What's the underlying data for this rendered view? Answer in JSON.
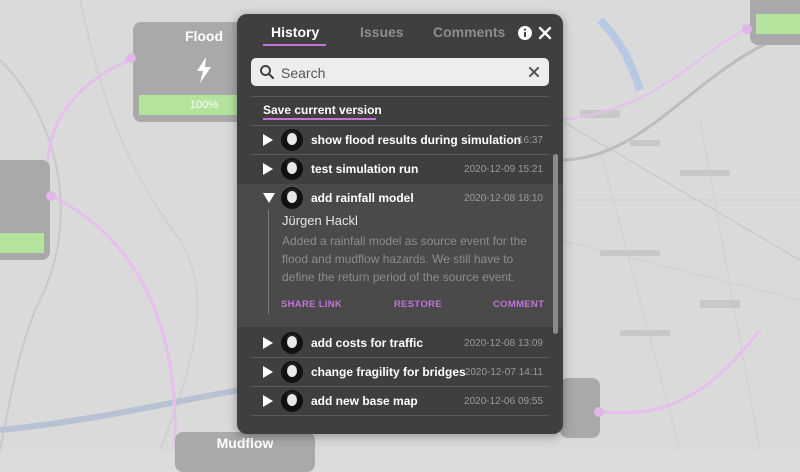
{
  "background_nodes": {
    "flood": {
      "title": "Flood",
      "progress_label": "100%",
      "progress": 1.0
    },
    "mudflow": {
      "title": "Mudflow"
    }
  },
  "panel": {
    "tabs": [
      "History",
      "Issues",
      "Comments"
    ],
    "active_tab": "History",
    "search": {
      "placeholder": "Search",
      "value": ""
    },
    "save_label": "Save current version",
    "history": [
      {
        "title": "show flood results during simulation",
        "time": "16:37"
      },
      {
        "title": "test simulation run",
        "time": "2020-12-09 15:21"
      },
      {
        "title": "add rainfall model",
        "time": "2020-12-08 18:10",
        "author": "Jürgen Hackl",
        "description": "Added a rainfall model as source event for the flood and mudflow hazards. We still have to define the return period of the source event."
      },
      {
        "title": "add costs for traffic",
        "time": "2020-12-08 13:09"
      },
      {
        "title": "change fragility for bridges",
        "time": "2020-12-07 14:11"
      },
      {
        "title": "add new base map",
        "time": "2020-12-06 09:55"
      }
    ],
    "actions": {
      "share": "SHARE LINK",
      "restore": "RESTORE",
      "comment": "COMMENT"
    }
  },
  "colors": {
    "accent": "#c074d6",
    "panel_bg": "#3f3f3f",
    "progress_green": "#b3e39d"
  },
  "icons": [
    "info-icon",
    "close-icon",
    "search-icon",
    "clear-icon",
    "lightning-icon"
  ]
}
